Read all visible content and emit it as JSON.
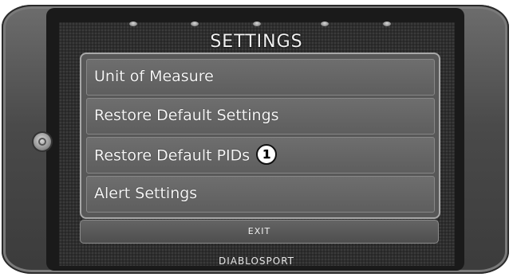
{
  "screen": {
    "title": "SETTINGS",
    "brand": "DIABLOSPORT"
  },
  "menu": {
    "items": [
      {
        "label": "Unit of Measure"
      },
      {
        "label": "Restore Default Settings"
      },
      {
        "label": "Restore Default PIDs",
        "callout": "1"
      },
      {
        "label": "Alert Settings"
      }
    ],
    "exit_label": "EXIT"
  },
  "colors": {
    "device_body": "#4a4a4a",
    "screen_bg": "#2e2e2e",
    "menu_item_bg": "#636363",
    "menu_border": "#a8a8a8",
    "text": "#f5f5f5"
  },
  "icons": [
    "indicator-light-icon",
    "power-button-icon"
  ]
}
